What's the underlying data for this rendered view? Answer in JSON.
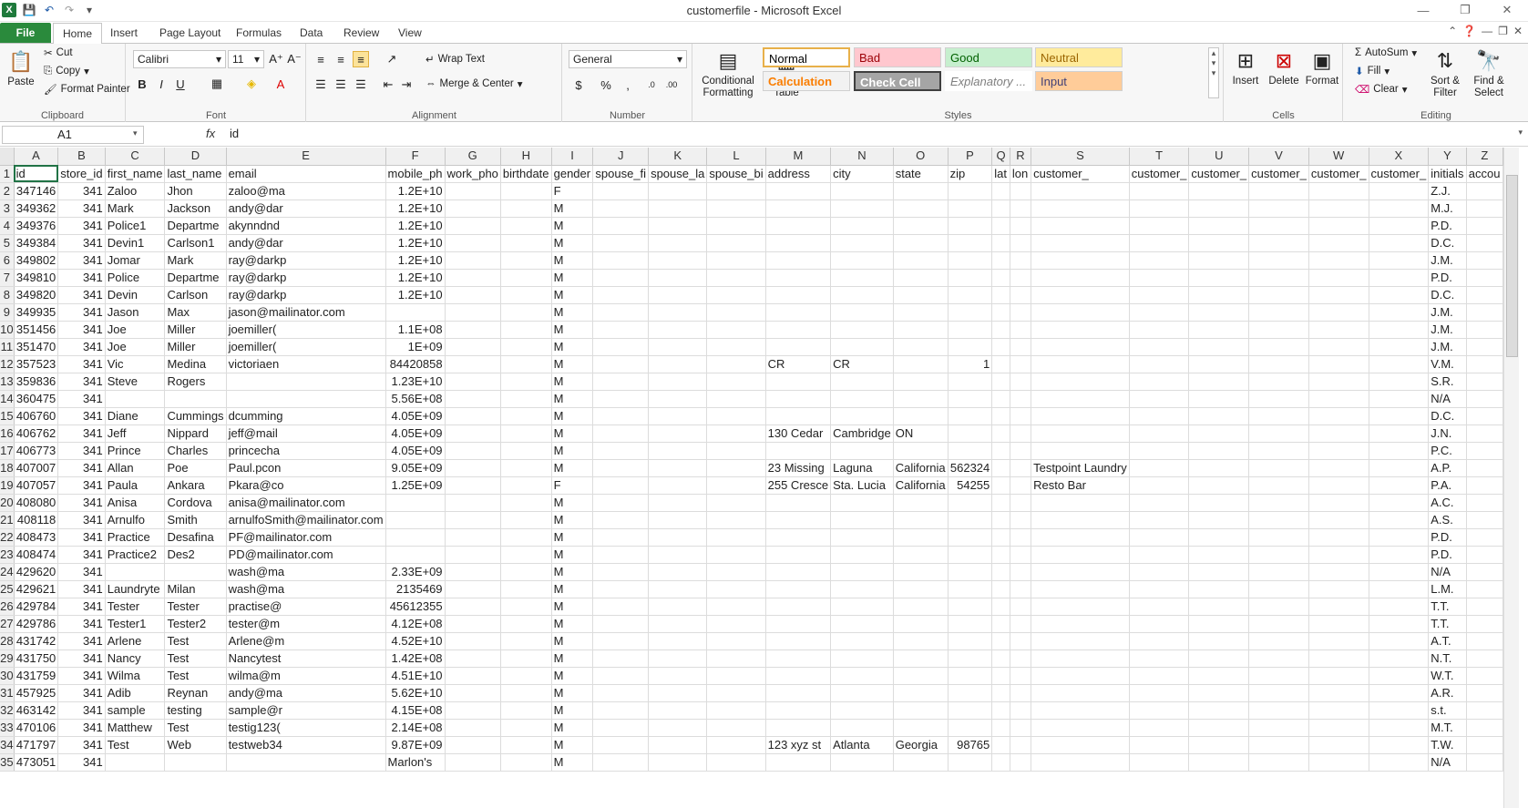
{
  "window": {
    "title": "customerfile - Microsoft Excel"
  },
  "qat": {
    "logo": "X",
    "save": "💾",
    "undo": "↶",
    "redo": "↷",
    "customize": "▾"
  },
  "tabs": {
    "file": "File",
    "items": [
      "Home",
      "Insert",
      "Page Layout",
      "Formulas",
      "Data",
      "Review",
      "View"
    ],
    "active": "Home"
  },
  "ribbon": {
    "clipboard": {
      "label": "Clipboard",
      "paste": "Paste",
      "cut": "Cut",
      "copy": "Copy",
      "format_painter": "Format Painter"
    },
    "font": {
      "label": "Font",
      "family": "Calibri",
      "size": "11"
    },
    "alignment": {
      "label": "Alignment",
      "wrap_text": "Wrap Text",
      "merge_center": "Merge & Center"
    },
    "number": {
      "label": "Number",
      "format": "General"
    },
    "styles": {
      "label": "Styles",
      "conditional_formatting": "Conditional Formatting",
      "format_as_table": "Format as Table",
      "cells": [
        {
          "name": "Normal",
          "bg": "#ffffff",
          "color": "#000000"
        },
        {
          "name": "Bad",
          "bg": "#ffc7ce",
          "color": "#9c0006"
        },
        {
          "name": "Good",
          "bg": "#c6efce",
          "color": "#006100"
        },
        {
          "name": "Neutral",
          "bg": "#ffeb9c",
          "color": "#9c6500"
        },
        {
          "name": "Calculation",
          "bg": "#f2f2f2",
          "color": "#fa7d00"
        },
        {
          "name": "Check Cell",
          "bg": "#a5a5a5",
          "color": "#ffffff"
        },
        {
          "name": "Explanatory ...",
          "bg": "#ffffff",
          "color": "#7f7f7f"
        },
        {
          "name": "Input",
          "bg": "#ffcc99",
          "color": "#3f3f76"
        }
      ]
    },
    "cells": {
      "label": "Cells",
      "insert": "Insert",
      "delete": "Delete",
      "format": "Format"
    },
    "editing": {
      "label": "Editing",
      "autosum": "AutoSum",
      "fill": "Fill",
      "clear": "Clear",
      "sort_filter": "Sort & Filter",
      "find_select": "Find & Select"
    }
  },
  "formula_bar": {
    "name_box": "A1",
    "fx": "fx",
    "formula": "id"
  },
  "sheet": {
    "columns": [
      "A",
      "B",
      "C",
      "D",
      "E",
      "F",
      "G",
      "H",
      "I",
      "J",
      "K",
      "L",
      "M",
      "N",
      "O",
      "P",
      "Q",
      "R",
      "S",
      "T",
      "U",
      "V",
      "W",
      "X",
      "Y",
      "Z"
    ],
    "rows": [
      [
        "id",
        "store_id",
        "first_name",
        "last_name",
        "email",
        "mobile_ph",
        "work_pho",
        "birthdate",
        "gender",
        "spouse_fi",
        "spouse_la",
        "spouse_bi",
        "address",
        "city",
        "state",
        "zip",
        "lat",
        "lon",
        "customer_",
        "customer_",
        "customer_",
        "customer_",
        "customer_",
        "customer_",
        "initials",
        "accou"
      ],
      [
        "347146",
        "341",
        "Zaloo",
        "Jhon",
        "zaloo@ma",
        "1.2E+10",
        "",
        "",
        "F",
        "",
        "",
        "",
        "",
        "",
        "",
        "",
        "",
        "",
        "",
        "",
        "",
        "",
        "",
        "",
        "Z.J.",
        ""
      ],
      [
        "349362",
        "341",
        "Mark",
        "Jackson",
        "andy@dar",
        "1.2E+10",
        "",
        "",
        "M",
        "",
        "",
        "",
        "",
        "",
        "",
        "",
        "",
        "",
        "",
        "",
        "",
        "",
        "",
        "",
        "M.J.",
        ""
      ],
      [
        "349376",
        "341",
        "Police1",
        "Departme",
        "akynndnd",
        "1.2E+10",
        "",
        "",
        "M",
        "",
        "",
        "",
        "",
        "",
        "",
        "",
        "",
        "",
        "",
        "",
        "",
        "",
        "",
        "",
        "P.D.",
        ""
      ],
      [
        "349384",
        "341",
        "Devin1",
        "Carlson1",
        "andy@dar",
        "1.2E+10",
        "",
        "",
        "M",
        "",
        "",
        "",
        "",
        "",
        "",
        "",
        "",
        "",
        "",
        "",
        "",
        "",
        "",
        "",
        "D.C.",
        ""
      ],
      [
        "349802",
        "341",
        "Jomar",
        "Mark",
        "ray@darkp",
        "1.2E+10",
        "",
        "",
        "M",
        "",
        "",
        "",
        "",
        "",
        "",
        "",
        "",
        "",
        "",
        "",
        "",
        "",
        "",
        "",
        "J.M.",
        ""
      ],
      [
        "349810",
        "341",
        "Police",
        "Departme",
        "ray@darkp",
        "1.2E+10",
        "",
        "",
        "M",
        "",
        "",
        "",
        "",
        "",
        "",
        "",
        "",
        "",
        "",
        "",
        "",
        "",
        "",
        "",
        "P.D.",
        ""
      ],
      [
        "349820",
        "341",
        "Devin",
        "Carlson",
        "ray@darkp",
        "1.2E+10",
        "",
        "",
        "M",
        "",
        "",
        "",
        "",
        "",
        "",
        "",
        "",
        "",
        "",
        "",
        "",
        "",
        "",
        "",
        "D.C.",
        ""
      ],
      [
        "349935",
        "341",
        "Jason",
        "Max",
        "jason@mailinator.com",
        "",
        "",
        "",
        "M",
        "",
        "",
        "",
        "",
        "",
        "",
        "",
        "",
        "",
        "",
        "",
        "",
        "",
        "",
        "",
        "J.M.",
        ""
      ],
      [
        "351456",
        "341",
        "Joe",
        "Miller",
        "joemiller(",
        "1.1E+08",
        "",
        "",
        "M",
        "",
        "",
        "",
        "",
        "",
        "",
        "",
        "",
        "",
        "",
        "",
        "",
        "",
        "",
        "",
        "J.M.",
        ""
      ],
      [
        "351470",
        "341",
        "Joe",
        "Miller",
        "joemiller(",
        "1E+09",
        "",
        "",
        "M",
        "",
        "",
        "",
        "",
        "",
        "",
        "",
        "",
        "",
        "",
        "",
        "",
        "",
        "",
        "",
        "J.M.",
        ""
      ],
      [
        "357523",
        "341",
        "Vic",
        "Medina",
        "victoriaen",
        "84420858",
        "",
        "",
        "M",
        "",
        "",
        "",
        "CR",
        "CR",
        "",
        "1",
        "",
        "",
        "",
        "",
        "",
        "",
        "",
        "",
        "V.M.",
        ""
      ],
      [
        "359836",
        "341",
        "Steve",
        "Rogers",
        "",
        "1.23E+10",
        "",
        "",
        "M",
        "",
        "",
        "",
        "",
        "",
        "",
        "",
        "",
        "",
        "",
        "",
        "",
        "",
        "",
        "",
        "S.R.",
        ""
      ],
      [
        "360475",
        "341",
        "",
        "",
        "",
        "5.56E+08",
        "",
        "",
        "M",
        "",
        "",
        "",
        "",
        "",
        "",
        "",
        "",
        "",
        "",
        "",
        "",
        "",
        "",
        "",
        "N/A",
        ""
      ],
      [
        "406760",
        "341",
        "Diane",
        "Cummings",
        "dcumming",
        "4.05E+09",
        "",
        "",
        "M",
        "",
        "",
        "",
        "",
        "",
        "",
        "",
        "",
        "",
        "",
        "",
        "",
        "",
        "",
        "",
        "D.C.",
        ""
      ],
      [
        "406762",
        "341",
        "Jeff",
        "Nippard",
        "jeff@mail",
        "4.05E+09",
        "",
        "",
        "M",
        "",
        "",
        "",
        "130 Cedar",
        "Cambridge",
        "ON",
        "",
        "",
        "",
        "",
        "",
        "",
        "",
        "",
        "",
        "J.N.",
        ""
      ],
      [
        "406773",
        "341",
        "Prince",
        "Charles",
        "princecha",
        "4.05E+09",
        "",
        "",
        "M",
        "",
        "",
        "",
        "",
        "",
        "",
        "",
        "",
        "",
        "",
        "",
        "",
        "",
        "",
        "",
        "P.C.",
        ""
      ],
      [
        "407007",
        "341",
        "Allan",
        "Poe",
        "Paul.pcon",
        "9.05E+09",
        "",
        "",
        "M",
        "",
        "",
        "",
        "23 Missing",
        "Laguna",
        "California",
        "562324",
        "",
        "",
        "Testpoint Laundry",
        "",
        "",
        "",
        "",
        "",
        "A.P.",
        ""
      ],
      [
        "407057",
        "341",
        "Paula",
        "Ankara",
        "Pkara@co",
        "1.25E+09",
        "",
        "",
        "F",
        "",
        "",
        "",
        "255 Cresce",
        "Sta. Lucia",
        "California",
        "54255",
        "",
        "",
        "Resto Bar",
        "",
        "",
        "",
        "",
        "",
        "P.A.",
        ""
      ],
      [
        "408080",
        "341",
        "Anisa",
        "Cordova",
        "anisa@mailinator.com",
        "",
        "",
        "",
        "M",
        "",
        "",
        "",
        "",
        "",
        "",
        "",
        "",
        "",
        "",
        "",
        "",
        "",
        "",
        "",
        "A.C.",
        ""
      ],
      [
        "408118",
        "341",
        "Arnulfo",
        "Smith",
        "arnulfoSmith@mailinator.com",
        "",
        "",
        "",
        "M",
        "",
        "",
        "",
        "",
        "",
        "",
        "",
        "",
        "",
        "",
        "",
        "",
        "",
        "",
        "",
        "A.S.",
        ""
      ],
      [
        "408473",
        "341",
        "Practice",
        "Desafina",
        "PF@mailinator.com",
        "",
        "",
        "",
        "M",
        "",
        "",
        "",
        "",
        "",
        "",
        "",
        "",
        "",
        "",
        "",
        "",
        "",
        "",
        "",
        "P.D.",
        ""
      ],
      [
        "408474",
        "341",
        "Practice2",
        "Des2",
        "PD@mailinator.com",
        "",
        "",
        "",
        "M",
        "",
        "",
        "",
        "",
        "",
        "",
        "",
        "",
        "",
        "",
        "",
        "",
        "",
        "",
        "",
        "P.D.",
        ""
      ],
      [
        "429620",
        "341",
        "",
        "",
        "wash@ma",
        "2.33E+09",
        "",
        "",
        "M",
        "",
        "",
        "",
        "",
        "",
        "",
        "",
        "",
        "",
        "",
        "",
        "",
        "",
        "",
        "",
        "N/A",
        ""
      ],
      [
        "429621",
        "341",
        "Laundryte",
        "Milan",
        "wash@ma",
        "2135469",
        "",
        "",
        "M",
        "",
        "",
        "",
        "",
        "",
        "",
        "",
        "",
        "",
        "",
        "",
        "",
        "",
        "",
        "",
        "L.M.",
        ""
      ],
      [
        "429784",
        "341",
        "Tester",
        "Tester",
        "practise@",
        "45612355",
        "",
        "",
        "M",
        "",
        "",
        "",
        "",
        "",
        "",
        "",
        "",
        "",
        "",
        "",
        "",
        "",
        "",
        "",
        "T.T.",
        ""
      ],
      [
        "429786",
        "341",
        "Tester1",
        "Tester2",
        "tester@m",
        "4.12E+08",
        "",
        "",
        "M",
        "",
        "",
        "",
        "",
        "",
        "",
        "",
        "",
        "",
        "",
        "",
        "",
        "",
        "",
        "",
        "T.T.",
        ""
      ],
      [
        "431742",
        "341",
        "Arlene",
        "Test",
        "Arlene@m",
        "4.52E+10",
        "",
        "",
        "M",
        "",
        "",
        "",
        "",
        "",
        "",
        "",
        "",
        "",
        "",
        "",
        "",
        "",
        "",
        "",
        "A.T.",
        ""
      ],
      [
        "431750",
        "341",
        "Nancy",
        "Test",
        "Nancytest",
        "1.42E+08",
        "",
        "",
        "M",
        "",
        "",
        "",
        "",
        "",
        "",
        "",
        "",
        "",
        "",
        "",
        "",
        "",
        "",
        "",
        "N.T.",
        ""
      ],
      [
        "431759",
        "341",
        "Wilma",
        "Test",
        "wilma@m",
        "4.51E+10",
        "",
        "",
        "M",
        "",
        "",
        "",
        "",
        "",
        "",
        "",
        "",
        "",
        "",
        "",
        "",
        "",
        "",
        "",
        "W.T.",
        ""
      ],
      [
        "457925",
        "341",
        "Adib",
        "Reynan",
        "andy@ma",
        "5.62E+10",
        "",
        "",
        "M",
        "",
        "",
        "",
        "",
        "",
        "",
        "",
        "",
        "",
        "",
        "",
        "",
        "",
        "",
        "",
        "A.R.",
        ""
      ],
      [
        "463142",
        "341",
        "sample",
        "testing",
        "sample@r",
        "4.15E+08",
        "",
        "",
        "M",
        "",
        "",
        "",
        "",
        "",
        "",
        "",
        "",
        "",
        "",
        "",
        "",
        "",
        "",
        "",
        "s.t.",
        ""
      ],
      [
        "470106",
        "341",
        "Matthew",
        "Test",
        "testig123(",
        "2.14E+08",
        "",
        "",
        "M",
        "",
        "",
        "",
        "",
        "",
        "",
        "",
        "",
        "",
        "",
        "",
        "",
        "",
        "",
        "",
        "M.T.",
        ""
      ],
      [
        "471797",
        "341",
        "Test",
        "Web",
        "testweb34",
        "9.87E+09",
        "",
        "",
        "M",
        "",
        "",
        "",
        "123 xyz st",
        "Atlanta",
        "Georgia",
        "98765",
        "",
        "",
        "",
        "",
        "",
        "",
        "",
        "",
        "T.W.",
        ""
      ],
      [
        "473051",
        "341",
        "",
        "",
        "",
        "Marlon's",
        "",
        "",
        "M",
        "",
        "",
        "",
        "",
        "",
        "",
        "",
        "",
        "",
        "",
        "",
        "",
        "",
        "",
        "",
        "N/A",
        ""
      ]
    ]
  }
}
